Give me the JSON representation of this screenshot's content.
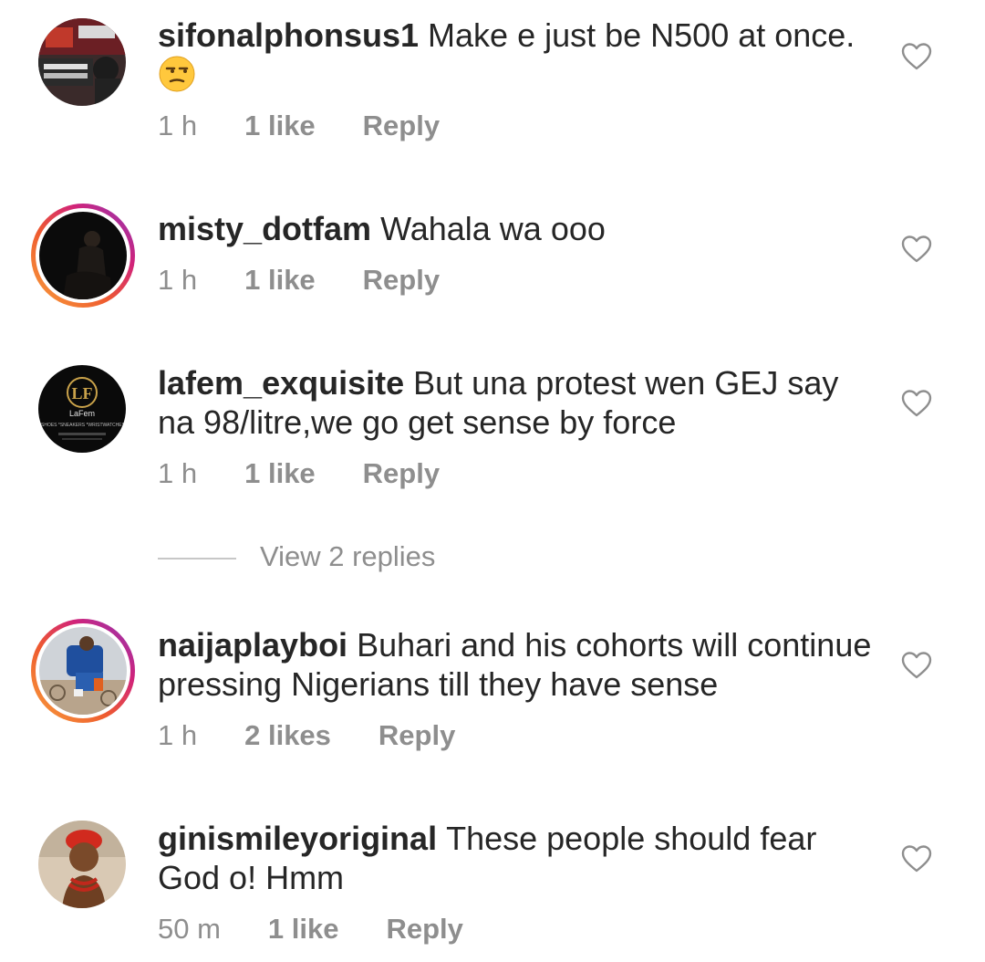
{
  "comments": [
    {
      "username": "sifonalphonsus1",
      "text": "Make e just be N500 at once.",
      "emoji": "unamused-face-emoji",
      "time": "1 h",
      "likes": "1 like",
      "reply": "Reply",
      "story_ring": false
    },
    {
      "username": "misty_dotfam",
      "text": "Wahala wa ooo",
      "time": "1 h",
      "likes": "1 like",
      "reply": "Reply",
      "story_ring": true
    },
    {
      "username": "lafem_exquisite",
      "text": "But una protest wen GEJ say na 98/litre,we go get sense by force",
      "time": "1 h",
      "likes": "1 like",
      "reply": "Reply",
      "story_ring": false,
      "avatar_logo": {
        "initials": "LF",
        "brand": "LaFem",
        "items": "*SHOES  *SNEAKERS  *WRISTWATCHES"
      }
    },
    {
      "username": "naijaplayboi",
      "text": "Buhari and his cohorts will continue pressing Nigerians till they have sense",
      "time": "1 h",
      "likes": "2 likes",
      "reply": "Reply",
      "story_ring": true
    },
    {
      "username": "ginismileyoriginal",
      "text": "These people should fear God o!  Hmm",
      "time": "50 m",
      "likes": "1 like",
      "reply": "Reply",
      "story_ring": false
    }
  ],
  "view_replies": "View 2 replies",
  "icons": {
    "like": "heart-outline-icon"
  },
  "colors": {
    "text": "#262626",
    "meta": "#8e8e8e",
    "divider": "#c7c7c7",
    "story_ring_start": "#f9a23c",
    "story_ring_end": "#8a3ab9"
  }
}
